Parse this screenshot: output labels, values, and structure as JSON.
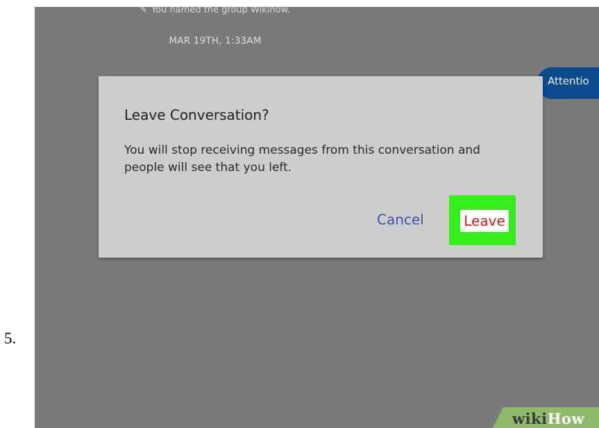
{
  "step": {
    "number": "5."
  },
  "chat": {
    "system_message": "You named the group Wikinow.",
    "system_icon": "pencil-icon",
    "timestamp": "MAR 19TH, 1:33AM",
    "bubble_text": "Attentio"
  },
  "dialog": {
    "title": "Leave Conversation?",
    "body": "You will stop receiving messages from this conversation and people will see that you left.",
    "cancel_label": "Cancel",
    "leave_label": "Leave"
  },
  "watermark": {
    "part1": "wiki",
    "part2": "How"
  },
  "colors": {
    "overlay": "#7a7a7a",
    "dialog_bg": "#cdcdcd",
    "cancel_text": "#3a56a8",
    "leave_text": "#d21f1f",
    "highlight": "#33ee1a",
    "bubble": "#0b4a8c"
  }
}
